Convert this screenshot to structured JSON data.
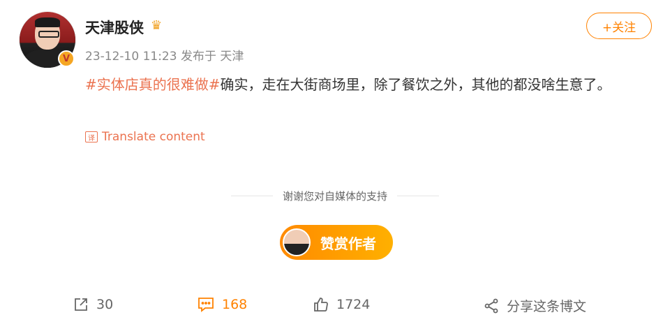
{
  "post": {
    "username": "天津股侠",
    "verified_badge": "V",
    "crown_icon": "♛",
    "timestamp": "23-12-10 11:23",
    "location": "发布于 天津",
    "follow_label": "+关注",
    "hashtag": "#实体店真的很难做#",
    "body_text": "确实，走在大街商场里，除了餐饮之外，其他的都没啥生意了。",
    "translate_label": "Translate content",
    "translate_icon": "译"
  },
  "support": {
    "text": "谢谢您对自媒体的支持",
    "reward_label": "赞赏作者"
  },
  "actions": {
    "repost_count": "30",
    "comment_count": "168",
    "like_count": "1724",
    "share_label": "分享这条博文"
  },
  "colors": {
    "accent": "#ff8200",
    "hashtag": "#eb7350"
  }
}
